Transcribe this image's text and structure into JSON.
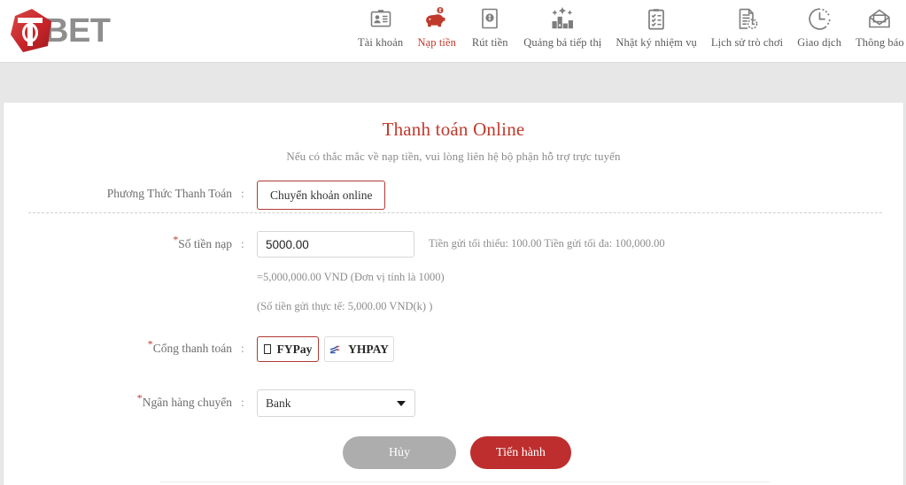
{
  "brand": {
    "logo_text": "BET",
    "logo_icon": "diamond-t-logo",
    "accent_red": "#c0392b",
    "logo_red": "#c8252a"
  },
  "nav": {
    "items": [
      {
        "icon": "id-card-icon",
        "label": "Tài khoản",
        "active": false
      },
      {
        "icon": "piggy-bank-icon",
        "label": "Nạp tiền",
        "active": true
      },
      {
        "icon": "banknote-icon",
        "label": "Rút tiền",
        "active": false
      },
      {
        "icon": "megaphone-bar-icon",
        "label": "Quảng bá tiếp thị",
        "active": false
      },
      {
        "icon": "clipboard-icon",
        "label": "Nhật ký nhiệm vụ",
        "active": false
      },
      {
        "icon": "document-clock-icon",
        "label": "Lịch sử trò chơi",
        "active": false
      },
      {
        "icon": "clock-icon",
        "label": "Giao dịch",
        "active": false
      },
      {
        "icon": "envelope-icon",
        "label": "Thông báo",
        "active": false
      }
    ]
  },
  "page": {
    "title": "Thanh toán Online",
    "subtitle": "Nếu có thắc mắc về nạp tiền, vui lòng liên hệ bộ phận hỗ trợ trực tuyến"
  },
  "form": {
    "colon": ":",
    "method": {
      "label": "Phương Thức Thanh Toán",
      "selected_button": "Chuyển khoản online"
    },
    "amount": {
      "label": "Số tiền nạp",
      "required": true,
      "value": "5000.00",
      "placeholder": "",
      "hint": "Tiền gửi tối thiểu: 100.00 Tiền gửi tối đa: 100,000.00",
      "converted": "=5,000,000.00 VND (Đơn vị tính là 1000)",
      "actual": "(Số tiền gửi thực tế: 5,000.00 VND(k) )"
    },
    "gateway": {
      "label": "Cổng thanh toán",
      "required": true,
      "options": [
        {
          "name": "FYPay",
          "icon": "missing-glyph-box",
          "selected": true
        },
        {
          "name": "YHPAY",
          "icon": "yhpay-logo-icon",
          "selected": false
        }
      ]
    },
    "bank": {
      "label": "Ngân hàng chuyển",
      "required": true,
      "selected": "Bank",
      "caret_icon": "chevron-down-icon"
    }
  },
  "actions": {
    "cancel": "Hủy",
    "submit": "Tiến hành"
  }
}
